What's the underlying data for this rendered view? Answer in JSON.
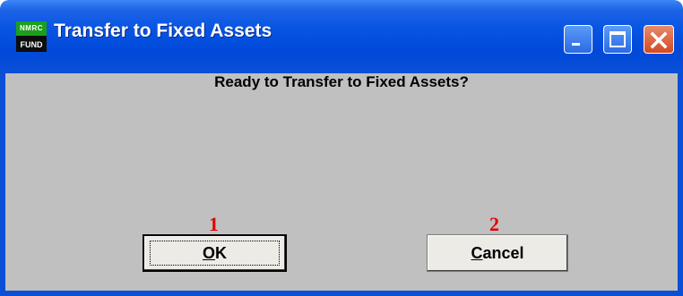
{
  "window": {
    "title": "Transfer to Fixed Assets",
    "app_icon": {
      "top_text": "NMRC",
      "bottom_text": "FUND"
    },
    "controls": {
      "minimize_icon": "minimize-icon",
      "maximize_icon": "maximize-icon",
      "close_icon": "close-icon"
    },
    "colors": {
      "titlebar": "#0054e3",
      "client_background": "#c0c0c0",
      "close_button": "#d24a22",
      "marker": "#e00000"
    }
  },
  "dialog": {
    "message": "Ready to Transfer to Fixed Assets?",
    "markers": [
      "1",
      "2"
    ],
    "ok_button": {
      "label_underlined": "O",
      "label_rest": "K"
    },
    "cancel_button": {
      "label_underlined": "C",
      "label_rest": "ancel"
    }
  }
}
